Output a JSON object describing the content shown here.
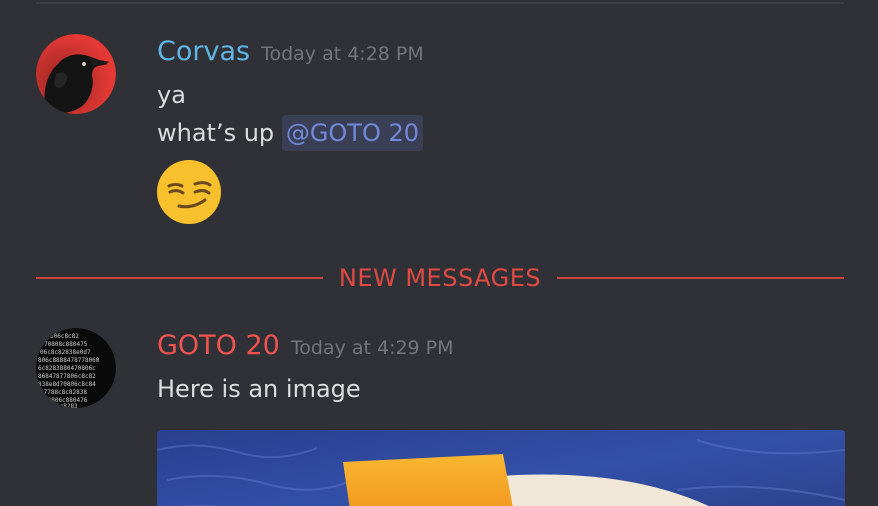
{
  "messages": [
    {
      "username": "Corvas",
      "timestamp": "Today at 4:28 PM",
      "lines": [
        "ya",
        "what’s up"
      ],
      "mention": "@GOTO 20",
      "emoji": "smirking-face-emoji"
    },
    {
      "username": "GOTO 20",
      "timestamp": "Today at 4:29 PM",
      "lines": [
        "Here is an image"
      ]
    }
  ],
  "divider": {
    "label": "NEW MESSAGES"
  },
  "colors": {
    "background": "#2f3136",
    "corvas_name": "#5fb5e3",
    "goto_name": "#ef5350",
    "new_messages": "#e04a43",
    "mention_text": "#7289da"
  }
}
